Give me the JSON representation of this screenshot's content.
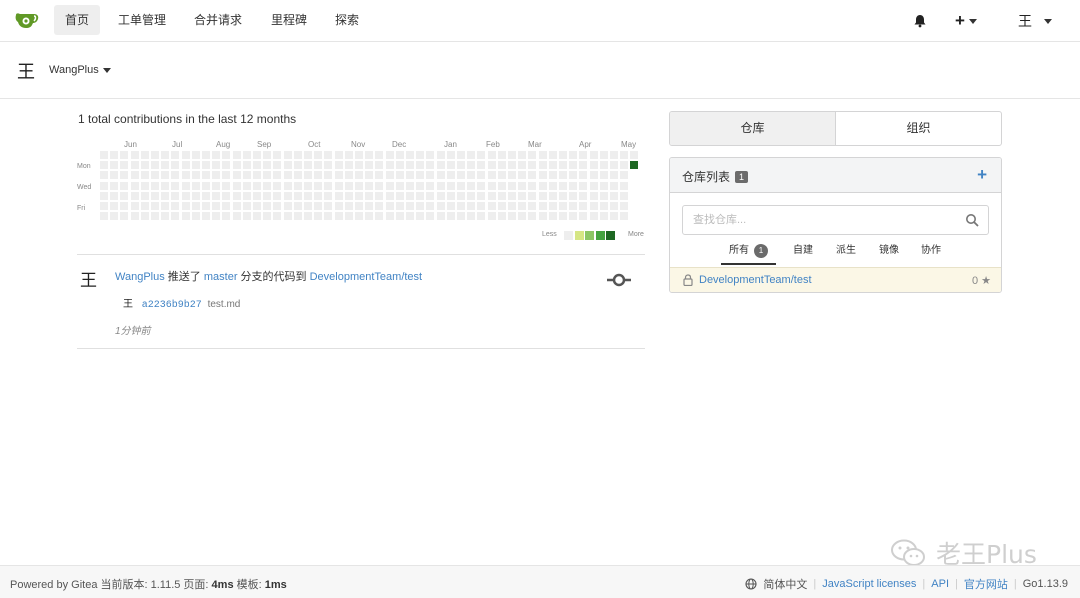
{
  "nav": {
    "items": [
      {
        "label": "首页",
        "active": true
      },
      {
        "label": "工单管理"
      },
      {
        "label": "合并请求"
      },
      {
        "label": "里程碑"
      },
      {
        "label": "探索"
      }
    ],
    "plus": "+",
    "user_char": "王",
    "icons": {
      "logo": "gitea-logo",
      "bell": "bell-icon"
    }
  },
  "user": {
    "char": "王",
    "name": "WangPlus"
  },
  "heatmap": {
    "title": "1 total contributions in the last 12 months",
    "months": [
      "Jun",
      "Jul",
      "Aug",
      "Sep",
      "Oct",
      "Nov",
      "Dec",
      "Jan",
      "Feb",
      "Mar",
      "Apr",
      "May"
    ],
    "day_labels": [
      "Mon",
      "Wed",
      "Fri"
    ],
    "legend_less": "Less",
    "legend_more": "More",
    "empty_color": "#eeeeee",
    "active_color": "#1e6823",
    "legend_colors": [
      "#eeeeee",
      "#d6e685",
      "#8cc665",
      "#44a340",
      "#1e6823"
    ],
    "active_cell": {
      "week": 52,
      "day": 1,
      "count": 1
    }
  },
  "feed": {
    "avatar": "王",
    "user": "WangPlus",
    "verb1": "推送了",
    "branch": "master",
    "verb2": "分支的代码到",
    "repo": "DevelopmentTeam/test",
    "commit_avatar": "王",
    "sha": "a2236b9b27",
    "message": "test.md",
    "time": "1分钟前"
  },
  "tabs": {
    "repos": "仓库",
    "orgs": "组织"
  },
  "repos": {
    "title": "仓库列表",
    "count": "1",
    "add": "+",
    "search_placeholder": "查找仓库...",
    "filters": {
      "all": "所有",
      "all_count": "1",
      "sources": "自建",
      "forks": "派生",
      "mirrors": "镜像",
      "collab": "协作"
    },
    "items": [
      {
        "name": "DevelopmentTeam/test",
        "stars": "0"
      }
    ]
  },
  "watermark": "老王Plus",
  "footer": {
    "powered": "Powered by Gitea 当前版本: 1.11.5 页面: ",
    "page_time": "4ms",
    "tmpl_label": " 模板: ",
    "tmpl_time": "1ms",
    "lang": "简体中文",
    "licenses": "JavaScript licenses",
    "api": "API",
    "site": "官方网站",
    "go": "Go1.13.9"
  }
}
